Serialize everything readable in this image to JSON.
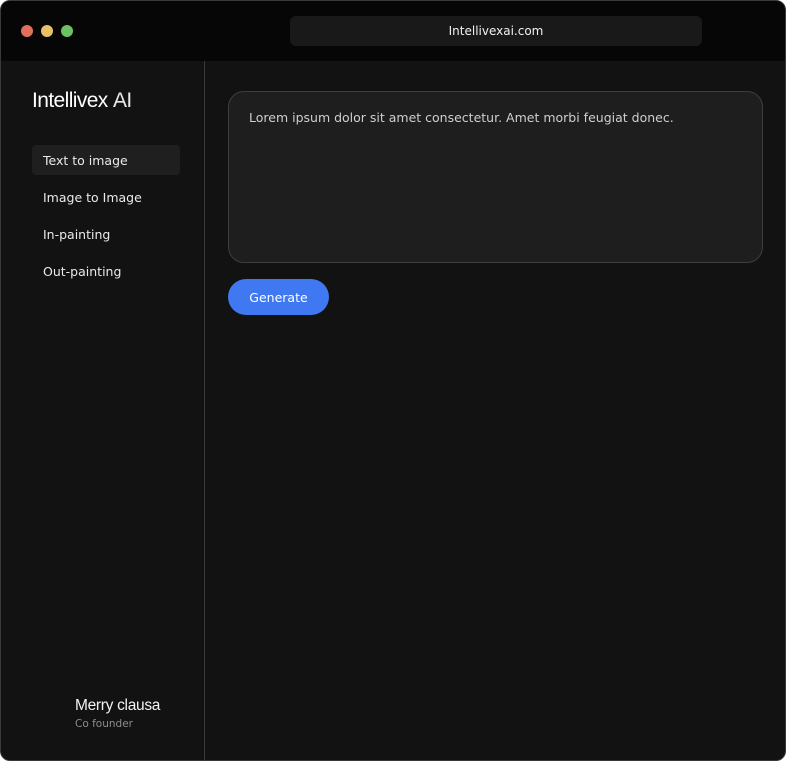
{
  "window": {
    "url": "Intellivexai.com",
    "controls": {
      "close_color": "#e0705c",
      "minimize_color": "#e9c06a",
      "maximize_color": "#6ec064"
    }
  },
  "sidebar": {
    "brand_name": "Intellivex",
    "brand_suffix": "AI",
    "items": [
      {
        "label": "Text to image",
        "active": true
      },
      {
        "label": "Image to Image",
        "active": false
      },
      {
        "label": "In-painting",
        "active": false
      },
      {
        "label": "Out-painting",
        "active": false
      }
    ],
    "profile": {
      "name": "Merry clausa",
      "role": "Co founder"
    }
  },
  "main": {
    "prompt_value": "Lorem ipsum dolor sit amet consectetur. Amet morbi feugiat donec.",
    "generate_label": "Generate",
    "accent_color": "#3f78f0"
  }
}
